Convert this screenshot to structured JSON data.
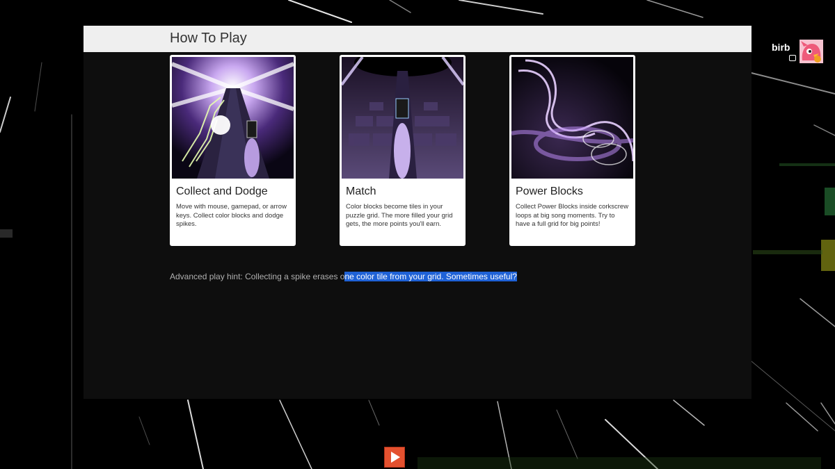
{
  "panel": {
    "title": "How To Play"
  },
  "cards": [
    {
      "title": "Collect and Dodge",
      "description": "Move with mouse, gamepad, or arrow keys. Collect color blocks and dodge spikes."
    },
    {
      "title": "Match",
      "description": "Color blocks become tiles in your puzzle grid. The more filled your grid gets, the more points you'll earn."
    },
    {
      "title": "Power Blocks",
      "description": "Collect Power Blocks inside corkscrew loops at big song moments. Try to have a full grid for big points!"
    }
  ],
  "hint": {
    "text_unselected": "Advanced play hint: Collecting a spike erases o",
    "text_selected": "ne color tile from your grid. Sometimes useful?"
  },
  "user": {
    "name": "birb",
    "avatar_icon": "pink-cartoon-avatar-icon"
  },
  "play_button": {
    "icon": "play-icon",
    "color": "#e4512f"
  },
  "colors": {
    "panel_header": "#efefef",
    "panel_body": "#0e0e0e",
    "selection": "#1f62d6",
    "accent_purple": "#a47ee0"
  }
}
